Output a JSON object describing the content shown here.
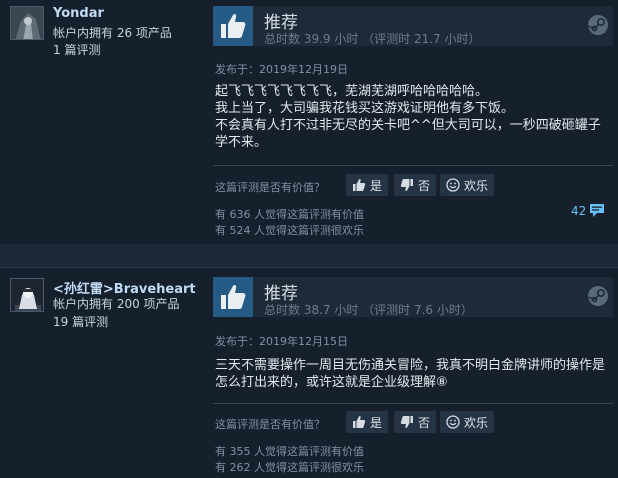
{
  "reviews": [
    {
      "username": "Yondar",
      "products": "帐户内拥有 26 项产品",
      "review_count": "1 篇评测",
      "recommendation": "推荐",
      "hours": "总时数 39.9 小时 （评测时 21.7 小时）",
      "posted": "发布于：2019年12月19日",
      "content_lines": [
        "起飞飞飞飞飞飞飞飞，芜湖芜湖呼哈哈哈哈哈。",
        "我上当了，大司骗我花钱买这游戏证明他有多下饭。",
        "不会真有人打不过非无尽的关卡吧^^但大司可以，一秒四破砸罐子",
        "学不来。"
      ],
      "helpful_question": "这篇评测是否有价值？",
      "yes_label": "是",
      "no_label": "否",
      "funny_label": "欢乐",
      "helpful_stat": "有 636 人觉得这篇评测有价值",
      "funny_stat": "有 524 人觉得这篇评测很欢乐",
      "comment_count": "42"
    },
    {
      "username": "<孙红雷>Braveheart",
      "products": "帐户内拥有 200 项产品",
      "review_count": "19 篇评测",
      "recommendation": "推荐",
      "hours": "总时数 38.7 小时 （评测时 7.6 小时）",
      "posted": "发布于：2019年12月15日",
      "content_lines": [
        "三天不需要操作一周目无伤通关冒险，我真不明白金牌讲师的操作是",
        "怎么打出来的，或许这就是企业级理解⑧"
      ],
      "helpful_question": "这篇评测是否有价值？",
      "yes_label": "是",
      "no_label": "否",
      "funny_label": "欢乐",
      "helpful_stat": "有 355 人觉得这篇评测有价值",
      "funny_stat": "有 262 人觉得这篇评测很欢乐"
    }
  ],
  "colors": {
    "background": "#16202d",
    "thumb_bg": "#245a84",
    "link": "#66c0f4"
  }
}
